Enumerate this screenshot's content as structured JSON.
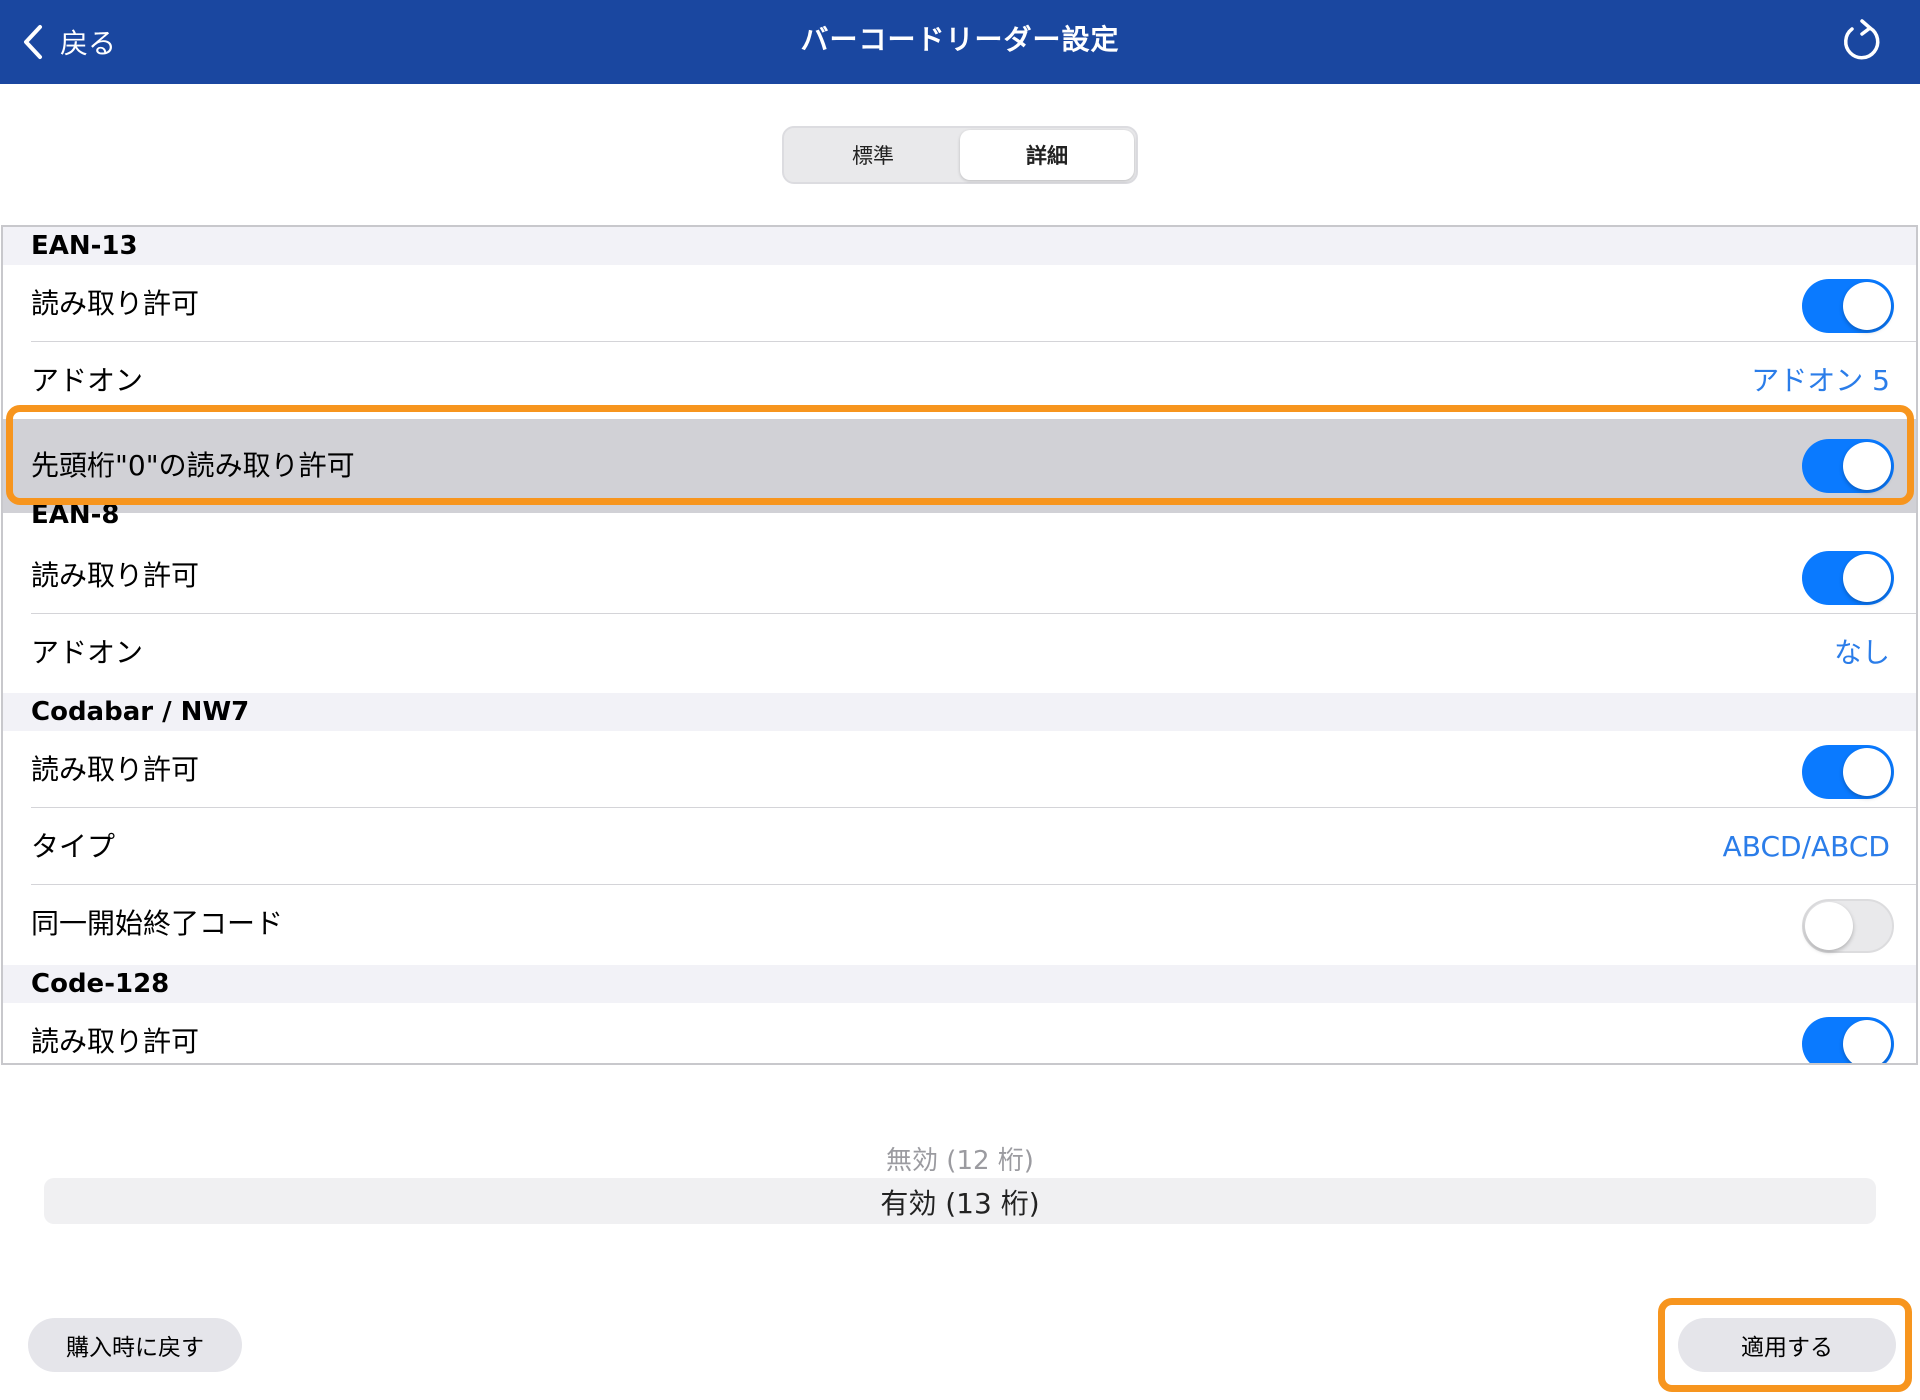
{
  "navbar": {
    "back_label": "戻る",
    "title": "バーコードリーダー設定",
    "back_icon": "chevron-left-icon",
    "refresh_icon": "refresh-icon"
  },
  "segmented": {
    "tabs": [
      {
        "label": "標準",
        "active": false
      },
      {
        "label": "詳細",
        "active": true
      }
    ]
  },
  "sections": {
    "ean13": {
      "header": "EAN-13",
      "read_allow": {
        "label": "読み取り許可",
        "on": true
      },
      "addon": {
        "label": "アドオン",
        "value": "アドオン 5"
      },
      "leading_zero": {
        "label": "先頭桁\"0\"の読み取り許可",
        "on": true
      }
    },
    "ean8": {
      "header": "EAN-8",
      "read_allow": {
        "label": "読み取り許可",
        "on": true
      },
      "addon": {
        "label": "アドオン",
        "value": "なし"
      }
    },
    "codabar": {
      "header": "Codabar / NW7",
      "read_allow": {
        "label": "読み取り許可",
        "on": true
      },
      "type": {
        "label": "タイプ",
        "value": "ABCD/ABCD"
      },
      "same_start_stop": {
        "label": "同一開始終了コード",
        "on": false
      }
    },
    "code128": {
      "header": "Code-128",
      "read_allow": {
        "label": "読み取り許可",
        "on": true
      }
    }
  },
  "picker": {
    "options": [
      "無効 (12 桁)",
      "有効 (13 桁)"
    ],
    "selected": "有効 (13 桁)"
  },
  "buttons": {
    "reset_label": "購入時に戻す",
    "apply_label": "適用する"
  },
  "colors": {
    "navbar": "#1a47a0",
    "accent": "#0a7aff",
    "link": "#2b7de9",
    "highlight": "#f7951e"
  }
}
